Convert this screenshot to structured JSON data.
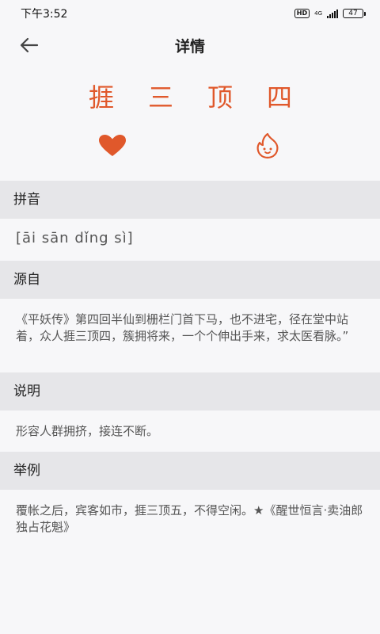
{
  "status_bar": {
    "time": "下午3:52",
    "hd": "HD",
    "network": "4G",
    "battery": "47"
  },
  "header": {
    "title": "详情",
    "back_icon": "arrow-left-icon"
  },
  "idiom": {
    "chars": [
      "捱",
      "三",
      "顶",
      "四"
    ]
  },
  "actions": {
    "favorite_icon": "heart-icon",
    "hot_icon": "flame-icon",
    "accent_color": "#e0582b"
  },
  "sections": {
    "pinyin": {
      "title": "拼音",
      "text": "[āi sān dǐng sì]"
    },
    "source": {
      "title": "源自",
      "text": "《平妖传》第四回半仙到栅栏门首下马，也不进宅，径在堂中站着，众人捱三顶四，簇拥将来，一个个伸出手来，求太医看脉。”"
    },
    "explain": {
      "title": "说明",
      "text": "形容人群拥挤，接连不断。"
    },
    "example": {
      "title": "举例",
      "text": "覆帐之后，宾客如市，捱三顶五，不得空闲。★《醒世恒言·卖油郎独占花魁》"
    }
  }
}
